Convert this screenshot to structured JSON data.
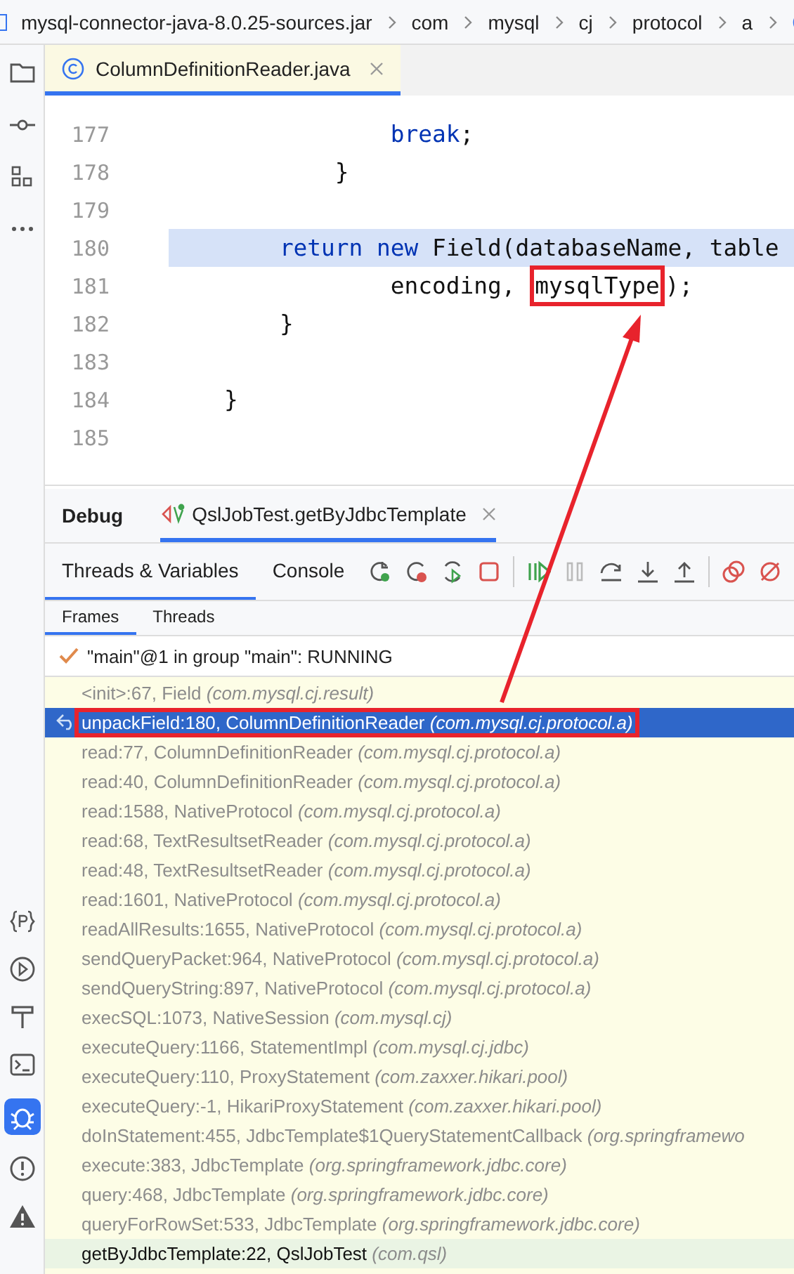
{
  "breadcrumb": [
    {
      "label": "mysql-connector-java-8.0.25-sources.jar"
    },
    {
      "label": "com"
    },
    {
      "label": "mysql"
    },
    {
      "label": "cj"
    },
    {
      "label": "protocol"
    },
    {
      "label": "a"
    }
  ],
  "editor_tab": {
    "label": "ColumnDefinitionReader.java",
    "selected": true
  },
  "code_lines": [
    {
      "number": "177",
      "current": false,
      "tokens": [
        {
          "text": "                break",
          "kind": "keyword"
        },
        {
          "text": ";",
          "kind": "plain"
        }
      ]
    },
    {
      "number": "178",
      "current": false,
      "tokens": [
        {
          "text": "            }",
          "kind": "plain"
        }
      ]
    },
    {
      "number": "179",
      "current": false
    },
    {
      "number": "180",
      "current": true,
      "tokens": [
        {
          "text": "        return new",
          "kind": "keyword"
        },
        {
          "text": " Field(databaseName, table",
          "kind": "plain"
        }
      ]
    },
    {
      "number": "181",
      "current": false,
      "tokens": [
        {
          "text": "                encoding, ",
          "kind": "plain"
        },
        {
          "text": "mysqlType",
          "kind": "plain",
          "boxed": true
        },
        {
          "text": ");",
          "kind": "plain"
        }
      ]
    },
    {
      "number": "182",
      "current": false,
      "tokens": [
        {
          "text": "        }",
          "kind": "plain"
        }
      ]
    },
    {
      "number": "183",
      "current": false
    },
    {
      "number": "184",
      "current": false,
      "tokens": [
        {
          "text": "    }",
          "kind": "plain"
        }
      ]
    },
    {
      "number": "185",
      "current": false
    }
  ],
  "debug": {
    "title": "Debug",
    "session_tab": {
      "label": "QslJobTest.getByJdbcTemplate",
      "selected": true
    },
    "tabs": [
      {
        "label": "Threads & Variables",
        "selected": true
      },
      {
        "label": "Console",
        "selected": false
      }
    ],
    "subtabs": [
      {
        "label": "Frames",
        "selected": true
      },
      {
        "label": "Threads",
        "selected": false
      }
    ],
    "thread": "\"main\"@1 in group \"main\": RUNNING",
    "frames": [
      {
        "method": "<init>:67, Field",
        "package": "(com.mysql.cj.result)",
        "library": true,
        "selected": false,
        "boxed": false
      },
      {
        "method": "unpackField:180, ColumnDefinitionReader",
        "package": "(com.mysql.cj.protocol.a)",
        "library": true,
        "selected": true,
        "boxed": true
      },
      {
        "method": "read:77, ColumnDefinitionReader",
        "package": "(com.mysql.cj.protocol.a)",
        "library": true,
        "selected": false,
        "boxed": false
      },
      {
        "method": "read:40, ColumnDefinitionReader",
        "package": "(com.mysql.cj.protocol.a)",
        "library": true,
        "selected": false,
        "boxed": false
      },
      {
        "method": "read:1588, NativeProtocol",
        "package": "(com.mysql.cj.protocol.a)",
        "library": true,
        "selected": false,
        "boxed": false
      },
      {
        "method": "read:68, TextResultsetReader",
        "package": "(com.mysql.cj.protocol.a)",
        "library": true,
        "selected": false,
        "boxed": false
      },
      {
        "method": "read:48, TextResultsetReader",
        "package": "(com.mysql.cj.protocol.a)",
        "library": true,
        "selected": false,
        "boxed": false
      },
      {
        "method": "read:1601, NativeProtocol",
        "package": "(com.mysql.cj.protocol.a)",
        "library": true,
        "selected": false,
        "boxed": false
      },
      {
        "method": "readAllResults:1655, NativeProtocol",
        "package": "(com.mysql.cj.protocol.a)",
        "library": true,
        "selected": false,
        "boxed": false
      },
      {
        "method": "sendQueryPacket:964, NativeProtocol",
        "package": "(com.mysql.cj.protocol.a)",
        "library": true,
        "selected": false,
        "boxed": false
      },
      {
        "method": "sendQueryString:897, NativeProtocol",
        "package": "(com.mysql.cj.protocol.a)",
        "library": true,
        "selected": false,
        "boxed": false
      },
      {
        "method": "execSQL:1073, NativeSession",
        "package": "(com.mysql.cj)",
        "library": true,
        "selected": false,
        "boxed": false
      },
      {
        "method": "executeQuery:1166, StatementImpl",
        "package": "(com.mysql.cj.jdbc)",
        "library": true,
        "selected": false,
        "boxed": false
      },
      {
        "method": "executeQuery:110, ProxyStatement",
        "package": "(com.zaxxer.hikari.pool)",
        "library": true,
        "selected": false,
        "boxed": false
      },
      {
        "method": "executeQuery:-1, HikariProxyStatement",
        "package": "(com.zaxxer.hikari.pool)",
        "library": true,
        "selected": false,
        "boxed": false
      },
      {
        "method": "doInStatement:455, JdbcTemplate$1QueryStatementCallback",
        "package": "(org.springframewo",
        "library": true,
        "selected": false,
        "boxed": false
      },
      {
        "method": "execute:383, JdbcTemplate",
        "package": "(org.springframework.jdbc.core)",
        "library": true,
        "selected": false,
        "boxed": false
      },
      {
        "method": "query:468, JdbcTemplate",
        "package": "(org.springframework.jdbc.core)",
        "library": true,
        "selected": false,
        "boxed": false
      },
      {
        "method": "queryForRowSet:533, JdbcTemplate",
        "package": "(org.springframework.jdbc.core)",
        "library": true,
        "selected": false,
        "boxed": false
      },
      {
        "method": "getByJdbcTemplate:22, QslJobTest",
        "package": "(com.qsl)",
        "library": false,
        "selected": false,
        "boxed": false
      }
    ]
  }
}
